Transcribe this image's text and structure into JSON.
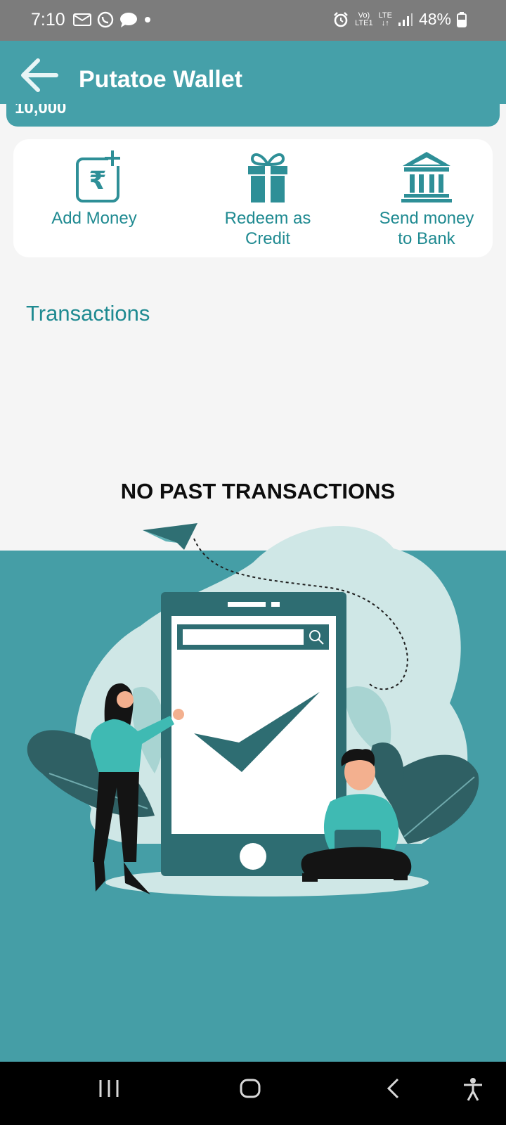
{
  "status_bar": {
    "time": "7:10",
    "battery": "48%"
  },
  "header": {
    "title": "Putatoe Wallet"
  },
  "wallet": {
    "balance_partial": "10,000"
  },
  "actions": [
    {
      "label": "Add Money",
      "icon": "rupee-add-icon"
    },
    {
      "label_line1": "Redeem as",
      "label_line2": "Credit",
      "icon": "gift-icon"
    },
    {
      "label_line1": "Send money",
      "label_line2": "to Bank",
      "icon": "bank-icon"
    }
  ],
  "transactions": {
    "title": "Transactions",
    "empty_message": "NO PAST TRANSACTIONS"
  },
  "colors": {
    "primary": "#45a0a9",
    "accent_text": "#1f8a91",
    "icon": "#2e8f97"
  }
}
